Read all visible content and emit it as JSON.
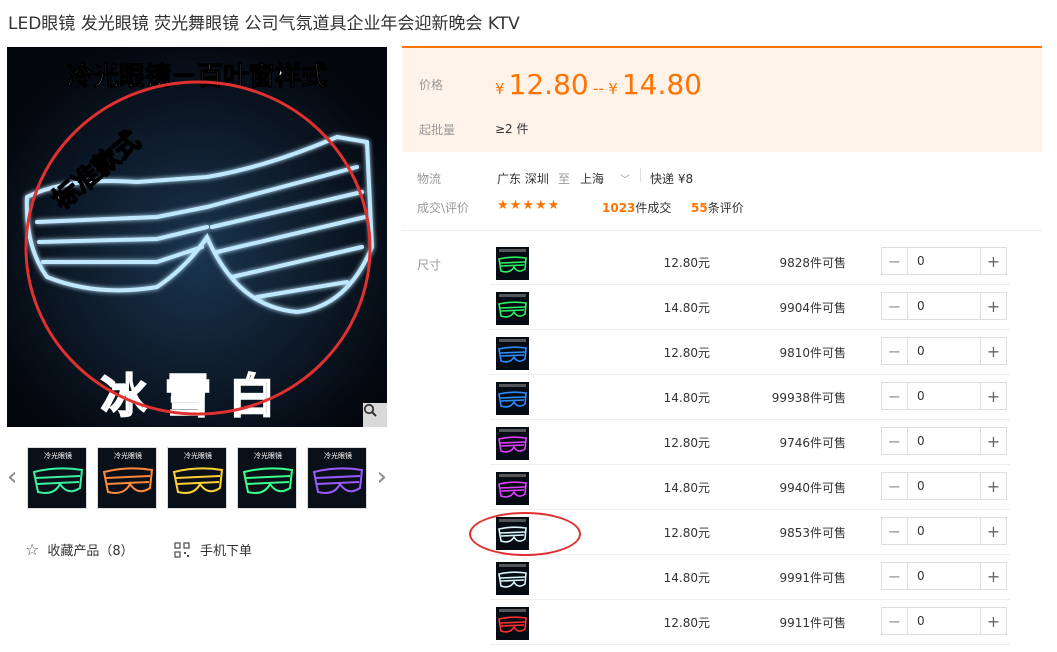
{
  "product": {
    "title": "LED眼镜 发光眼镜 荧光舞眼镜 公司气氛道具企业年会迎新晚会 KTV"
  },
  "main_image": {
    "caption_top": "冷光眼镜－百叶窗样式",
    "stamp": "标准款式",
    "caption_bottom": "冰雪白",
    "glow_color": "#bfe8ff",
    "annotation_color": "#e03030"
  },
  "thumbnails": [
    {
      "color": "#3af0a0"
    },
    {
      "color": "#ff8a3a"
    },
    {
      "color": "#ffcf3a"
    },
    {
      "color": "#3aff8a"
    },
    {
      "color": "#9a5aff"
    }
  ],
  "actions": {
    "favorite_label": "收藏产品（8）",
    "mobile_label": "手机下单"
  },
  "price": {
    "label": "价格",
    "currency": "¥",
    "min": "12.80",
    "range_sep": "--",
    "max": "14.80",
    "moq_label": "起批量",
    "moq_value": "≥2 件"
  },
  "logistics": {
    "label": "物流",
    "from": "广东 深圳",
    "to_word": "至",
    "to": "上海",
    "shipping": "快递 ¥8"
  },
  "deals": {
    "label": "成交\\评价",
    "stars": "★★★★★",
    "sold_count": "1023",
    "sold_suffix": "件成交",
    "review_count": "55",
    "review_suffix": "条评价"
  },
  "sku": {
    "label": "尺寸",
    "stock_suffix": "件可售",
    "rows": [
      {
        "price": "12.80元",
        "stock": "9828",
        "qty": "0",
        "color": "#2ef060"
      },
      {
        "price": "14.80元",
        "stock": "9904",
        "qty": "0",
        "color": "#2ef060"
      },
      {
        "price": "12.80元",
        "stock": "9810",
        "qty": "0",
        "color": "#2a8cff"
      },
      {
        "price": "14.80元",
        "stock": "99938",
        "qty": "0",
        "color": "#2a8cff"
      },
      {
        "price": "12.80元",
        "stock": "9746",
        "qty": "0",
        "color": "#e040ff"
      },
      {
        "price": "14.80元",
        "stock": "9940",
        "qty": "0",
        "color": "#e040ff"
      },
      {
        "price": "12.80元",
        "stock": "9853",
        "qty": "0",
        "color": "#d8f4ff"
      },
      {
        "price": "14.80元",
        "stock": "9991",
        "qty": "0",
        "color": "#d8f4ff"
      },
      {
        "price": "12.80元",
        "stock": "9911",
        "qty": "0",
        "color": "#ff3030"
      }
    ]
  }
}
